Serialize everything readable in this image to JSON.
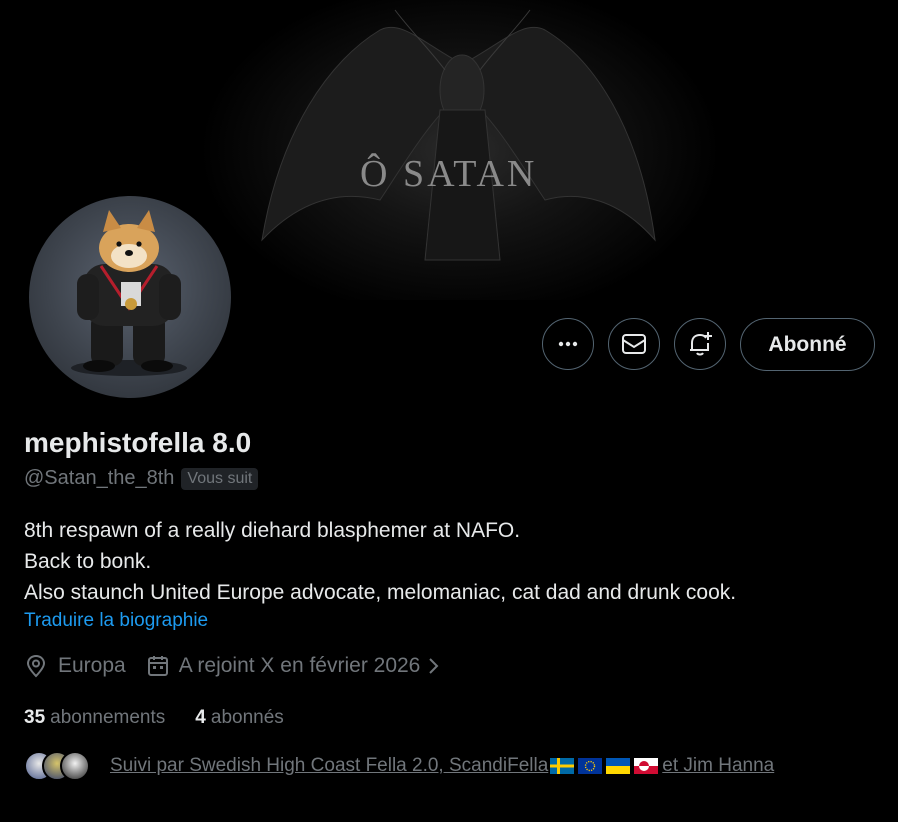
{
  "banner": {
    "text": "Ô SATAN"
  },
  "actions": {
    "more_icon": "more-icon",
    "message_icon": "envelope-icon",
    "notify_icon": "bell-plus-icon",
    "follow_label": "Abonné"
  },
  "profile": {
    "name": "mephistofella 8.0",
    "handle": "@Satan_the_8th",
    "follows_you": "Vous suit",
    "bio": [
      "8th respawn of a really diehard blasphemer at NAFO.",
      "Back to bonk.",
      "Also staunch United Europe advocate, melomaniac, cat dad and drunk cook."
    ],
    "translate_label": "Traduire la biographie",
    "location": "Europa",
    "joined": "A rejoint X en février 2026",
    "following_count": "35",
    "following_label": "abonnements",
    "followers_count": "4",
    "followers_label": "abonnés"
  },
  "followed_by": {
    "prefix": "Suivi par Swedish High Coast Fella 2.0, ScandiFella",
    "suffix": "et Jim Hanna",
    "flags": [
      "sweden-flag",
      "eu-flag",
      "ukraine-flag",
      "greenland-flag"
    ]
  },
  "colors": {
    "accent": "#1d9bf0",
    "muted": "#71767b",
    "text": "#e7e9ea",
    "border": "#536471"
  }
}
